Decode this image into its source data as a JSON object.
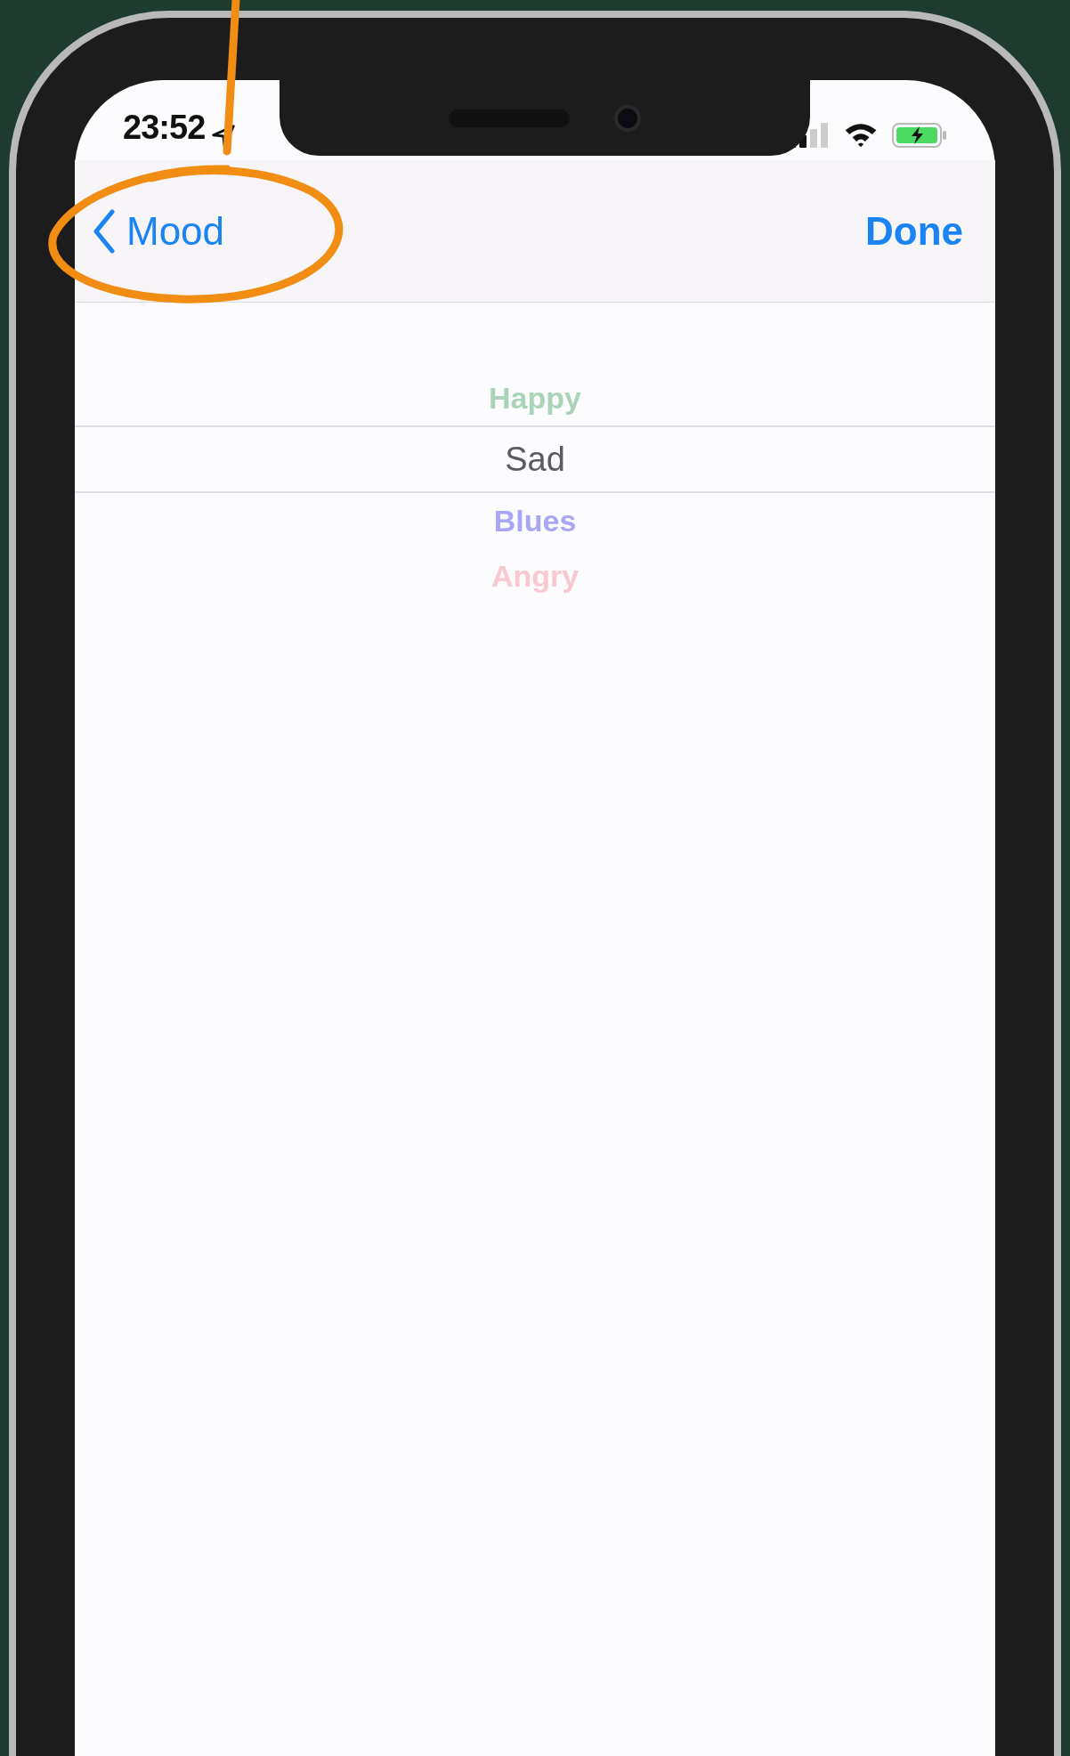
{
  "status_bar": {
    "time": "23:52"
  },
  "nav_bar": {
    "back_label": "Mood",
    "action": "Done"
  },
  "picker": {
    "items": [
      {
        "label": "Happy",
        "color": "#a9d4b8",
        "selected": false
      },
      {
        "label": "Sad",
        "color": "#5c5a60",
        "selected": true
      },
      {
        "label": "Blues",
        "color": "#a9a6f6",
        "selected": false
      },
      {
        "label": "Angry",
        "color": "#f8c9d0",
        "selected": false
      }
    ]
  }
}
